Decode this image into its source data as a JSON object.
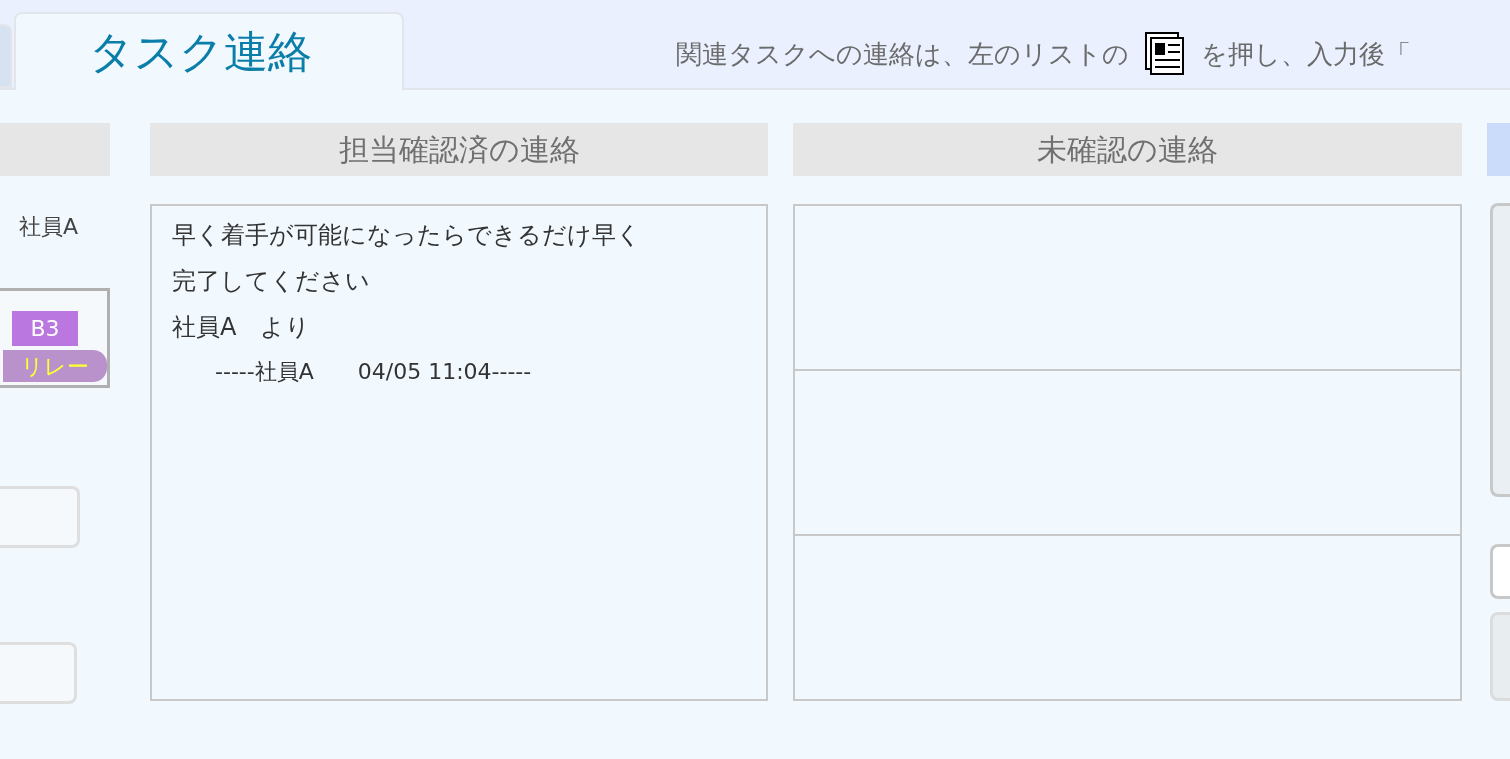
{
  "tabs": [
    {
      "selected": false
    },
    {
      "label": "タスク連絡",
      "selected": true
    }
  ],
  "instruction": {
    "before": "関連タスクへの連絡は、左のリストの",
    "after": "を押し、入力後「"
  },
  "left_column": {
    "person": "社員A",
    "card": {
      "badge": "B3",
      "tag": "リレー"
    }
  },
  "confirmed_column": {
    "title": "担当確認済の連絡",
    "messages": [
      {
        "lines": [
          "早く着手が可能になったらできるだけ早く",
          "完了してください",
          "社員A　より"
        ],
        "footer": "-----社員A　　04/05 11:04-----"
      }
    ]
  },
  "unconfirmed_column": {
    "title": "未確認の連絡"
  }
}
